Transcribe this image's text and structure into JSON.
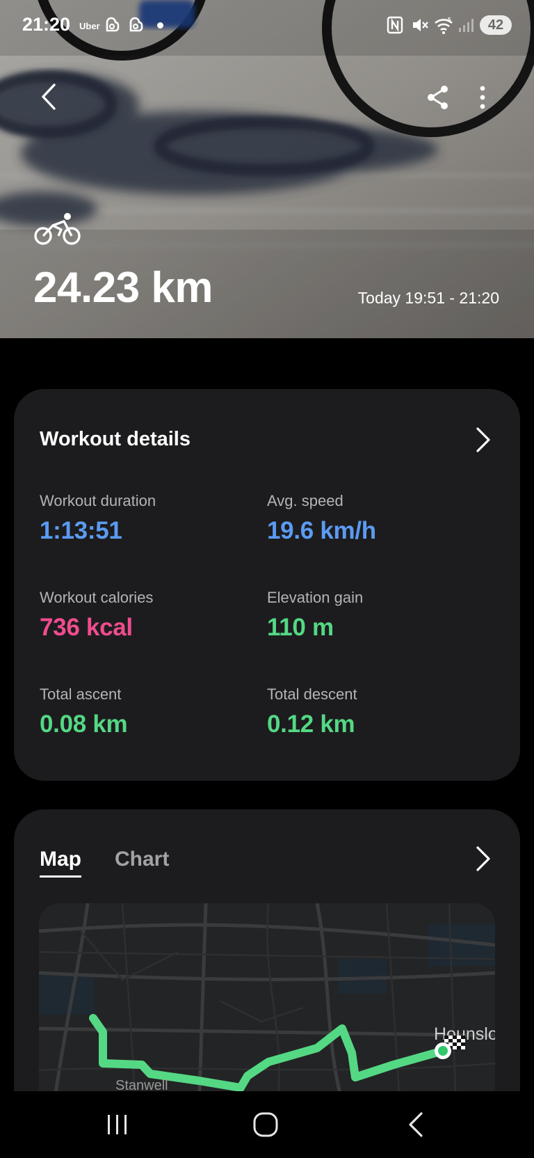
{
  "status_bar": {
    "time": "21:20",
    "uber_label": "Uber",
    "battery": "42",
    "icons": [
      "nfc-icon",
      "mute-icon",
      "wifi-icon",
      "signal-icon"
    ]
  },
  "hero": {
    "distance": "24.23 km",
    "time_range": "Today 19:51 - 21:20",
    "sport_icon": "cycling-icon"
  },
  "workout_details": {
    "title": "Workout details",
    "stats": [
      {
        "label": "Workout duration",
        "value": "1:13:51",
        "color": "#5b9bf3"
      },
      {
        "label": "Avg. speed",
        "value": "19.6 km/h",
        "color": "#5b9bf3"
      },
      {
        "label": "Workout calories",
        "value": "736 kcal",
        "color": "#f04c8e"
      },
      {
        "label": "Elevation gain",
        "value": "110 m",
        "color": "#54d884"
      },
      {
        "label": "Total ascent",
        "value": "0.08 km",
        "color": "#54d884"
      },
      {
        "label": "Total descent",
        "value": "0.12 km",
        "color": "#54d884"
      }
    ]
  },
  "route": {
    "tabs": [
      {
        "label": "Map",
        "active": true
      },
      {
        "label": "Chart",
        "active": false
      }
    ],
    "map_labels": [
      "Hounslow",
      "Stanwell"
    ],
    "route_color": "#54d884"
  },
  "colors": {
    "background": "#000000",
    "card": "#1c1c1e",
    "accent_blue": "#5b9bf3",
    "accent_pink": "#f04c8e",
    "accent_green": "#54d884"
  }
}
